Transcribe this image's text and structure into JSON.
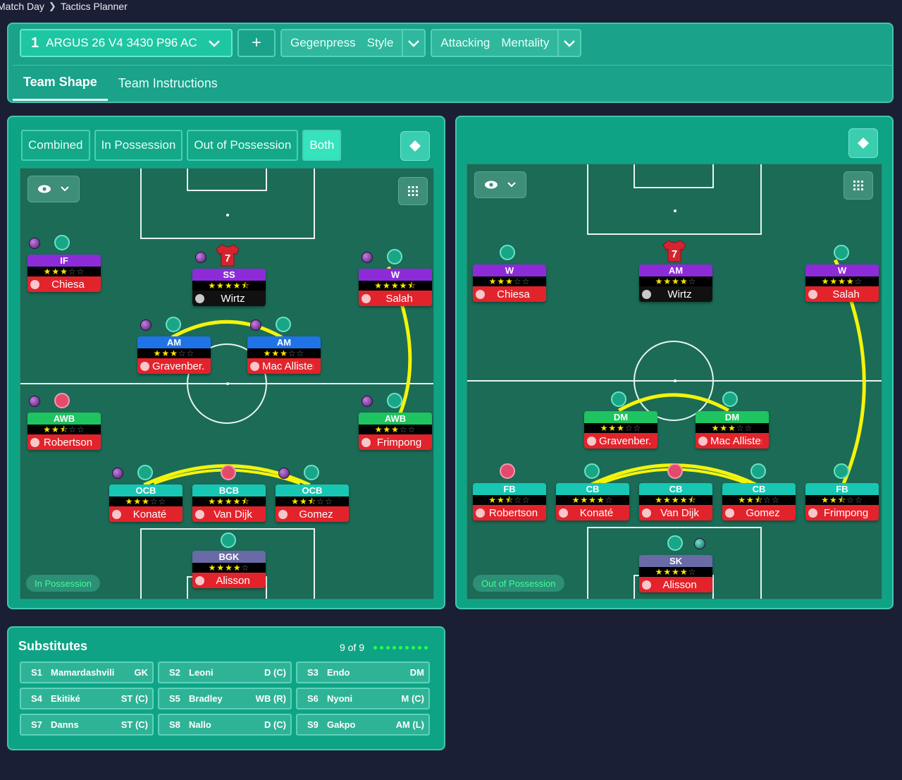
{
  "breadcrumb": {
    "parent": "Match Day",
    "current": "Tactics Planner"
  },
  "header": {
    "tactic_number": "1",
    "tactic_name": "ARGUS 26 V4 3430 P96 AC",
    "add_label": "+",
    "style_value": "Gegenpress",
    "style_label": "Style",
    "mentality_value": "Attacking",
    "mentality_label": "Mentality",
    "tabs": [
      {
        "label": "Team Shape"
      },
      {
        "label": "Team Instructions"
      }
    ]
  },
  "left_panel": {
    "tabs": [
      {
        "label": "Combined"
      },
      {
        "label": "In Possession"
      },
      {
        "label": "Out of Possession"
      },
      {
        "label": "Both"
      }
    ],
    "phase_label": "In Possession",
    "players": [
      {
        "role": "IF",
        "stars": 3,
        "name": "Chiesa"
      },
      {
        "role": "SS",
        "stars": 4.5,
        "name": "Wirtz",
        "shirt": "7"
      },
      {
        "role": "W",
        "stars": 4.5,
        "name": "Salah"
      },
      {
        "role": "AM",
        "stars": 3,
        "name": "Gravenber..."
      },
      {
        "role": "AM",
        "stars": 3,
        "name": "Mac Allister"
      },
      {
        "role": "AWB",
        "stars": 2.5,
        "name": "Robertson"
      },
      {
        "role": "AWB",
        "stars": 3,
        "name": "Frimpong"
      },
      {
        "role": "OCB",
        "stars": 3,
        "name": "Konaté"
      },
      {
        "role": "BCB",
        "stars": 4.5,
        "name": "Van Dijk"
      },
      {
        "role": "OCB",
        "stars": 2.5,
        "name": "Gomez"
      },
      {
        "role": "BGK",
        "stars": 4,
        "name": "Alisson"
      }
    ]
  },
  "right_panel": {
    "phase_label": "Out of Possession",
    "players": [
      {
        "role": "W",
        "stars": 3,
        "name": "Chiesa"
      },
      {
        "role": "AM",
        "stars": 4,
        "name": "Wirtz",
        "shirt": "7"
      },
      {
        "role": "W",
        "stars": 4,
        "name": "Salah"
      },
      {
        "role": "DM",
        "stars": 3,
        "name": "Gravenber..."
      },
      {
        "role": "DM",
        "stars": 3,
        "name": "Mac Allister"
      },
      {
        "role": "FB",
        "stars": 2.5,
        "name": "Robertson"
      },
      {
        "role": "CB",
        "stars": 4,
        "name": "Konaté"
      },
      {
        "role": "CB",
        "stars": 4.5,
        "name": "Van Dijk"
      },
      {
        "role": "CB",
        "stars": 2.5,
        "name": "Gomez"
      },
      {
        "role": "FB",
        "stars": 2.5,
        "name": "Frimpong"
      },
      {
        "role": "SK",
        "stars": 4,
        "name": "Alisson"
      }
    ]
  },
  "substitutes": {
    "title": "Substitutes",
    "count": "9 of 9",
    "items": [
      {
        "slot": "S1",
        "name": "Mamardashvili",
        "pos": "GK"
      },
      {
        "slot": "S2",
        "name": "Leoni",
        "pos": "D (C)"
      },
      {
        "slot": "S3",
        "name": "Endo",
        "pos": "DM"
      },
      {
        "slot": "S4",
        "name": "Ekitiké",
        "pos": "ST (C)"
      },
      {
        "slot": "S5",
        "name": "Bradley",
        "pos": "WB (R)"
      },
      {
        "slot": "S6",
        "name": "Nyoni",
        "pos": "M (C)"
      },
      {
        "slot": "S7",
        "name": "Danns",
        "pos": "ST (C)"
      },
      {
        "slot": "S8",
        "name": "Nallo",
        "pos": "D (C)"
      },
      {
        "slot": "S9",
        "name": "Gakpo",
        "pos": "AM (L)"
      }
    ]
  },
  "colors": {
    "accent": "#1fc6a3",
    "pitch": "#1b6b57",
    "link": "#f4f40a",
    "name_bar": "#e3232b"
  }
}
